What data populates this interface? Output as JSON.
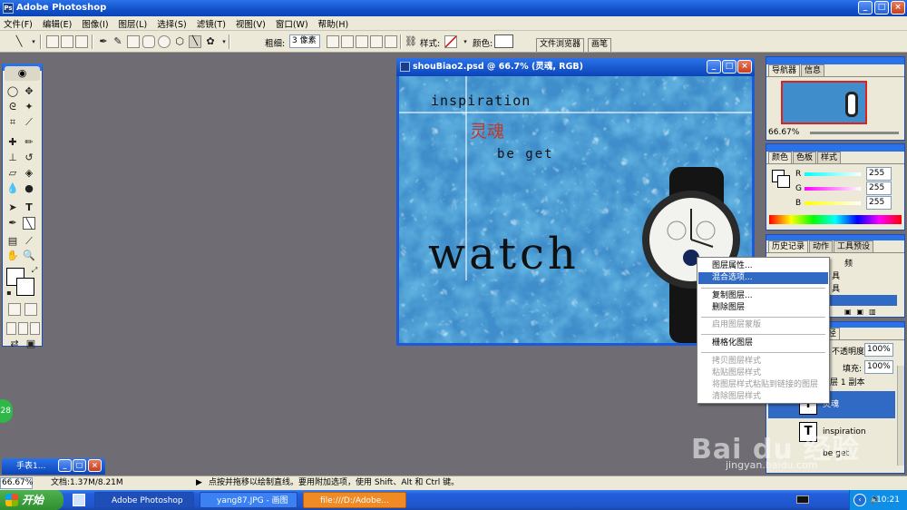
{
  "app": {
    "title": "Adobe Photoshop"
  },
  "menu": [
    "文件(F)",
    "编辑(E)",
    "图像(I)",
    "图层(L)",
    "选择(S)",
    "滤镜(T)",
    "视图(V)",
    "窗口(W)",
    "帮助(H)"
  ],
  "options": {
    "thickness_label": "粗细:",
    "thickness_value": "3 像素",
    "style_label": "样式:",
    "color_label": "颜色:",
    "file_browser_tab": "文件浏览器",
    "brushes_tab": "画笔"
  },
  "document": {
    "title": "shouBiao2.psd @ 66.7% (灵魂, RGB)",
    "text_inspiration": "inspiration",
    "text_soul": "灵魂",
    "text_beget": "be get",
    "text_watch": "watch"
  },
  "navigator": {
    "tabs": [
      "导航器",
      "信息"
    ],
    "zoom": "66.67%"
  },
  "color_panel": {
    "tabs": [
      "颜色",
      "色板",
      "样式"
    ],
    "channels": [
      {
        "label": "R",
        "value": "255"
      },
      {
        "label": "G",
        "value": "255"
      },
      {
        "label": "B",
        "value": "255"
      }
    ]
  },
  "history_panel": {
    "tabs": [
      "历史记录",
      "动作",
      "工具预设"
    ],
    "items": [
      "频",
      "具",
      "具"
    ]
  },
  "layers_panel": {
    "tab_suffix": "径",
    "opacity_label": "不透明度:",
    "opacity_value": "100%",
    "fill_label": "填充:",
    "fill_value": "100%",
    "layers": [
      {
        "name": "层 1 副本",
        "selected": false
      },
      {
        "name": "灵魂",
        "selected": true
      },
      {
        "name": "inspiration",
        "selected": false
      },
      {
        "name": "be get",
        "selected": false
      }
    ]
  },
  "context_menu": {
    "items": [
      {
        "label": "图层属性...",
        "disabled": false,
        "highlight": false
      },
      {
        "label": "混合选项...",
        "disabled": false,
        "highlight": true
      },
      {
        "label": "复制图层...",
        "disabled": false,
        "highlight": false
      },
      {
        "label": "删除图层",
        "disabled": false,
        "highlight": false
      },
      {
        "label": "启用图层蒙版",
        "disabled": true,
        "highlight": false
      },
      {
        "label": "栅格化图层",
        "disabled": false,
        "highlight": false
      },
      {
        "label": "拷贝图层样式",
        "disabled": true,
        "highlight": false
      },
      {
        "label": "粘贴图层样式",
        "disabled": true,
        "highlight": false
      },
      {
        "label": "将图层样式粘贴到链接的图层",
        "disabled": true,
        "highlight": false
      },
      {
        "label": "清除图层样式",
        "disabled": true,
        "highlight": false
      }
    ]
  },
  "minimized_window": {
    "title": "手表1..."
  },
  "status": {
    "zoom": "66.67%",
    "doc": "文档:1.37M/8.21M",
    "hint": "点按并拖移以绘制直线。要用附加选项，使用 Shift、Alt 和 Ctrl 键。"
  },
  "badge": {
    "value": "28"
  },
  "taskbar": {
    "start": "开始",
    "tasks": [
      "Adobe Photoshop",
      "yang87.JPG - 画图",
      "file:///D:/Adobe..."
    ],
    "clock": "10:21"
  },
  "watermark": {
    "text": "Bai du 经验",
    "url": "jingyan.baidu.com"
  },
  "colors": {
    "accent": "#316ac5",
    "title_blue": "#2b72e8",
    "soul_red": "#c0392b",
    "taskbar_orange": "#f08a24"
  }
}
